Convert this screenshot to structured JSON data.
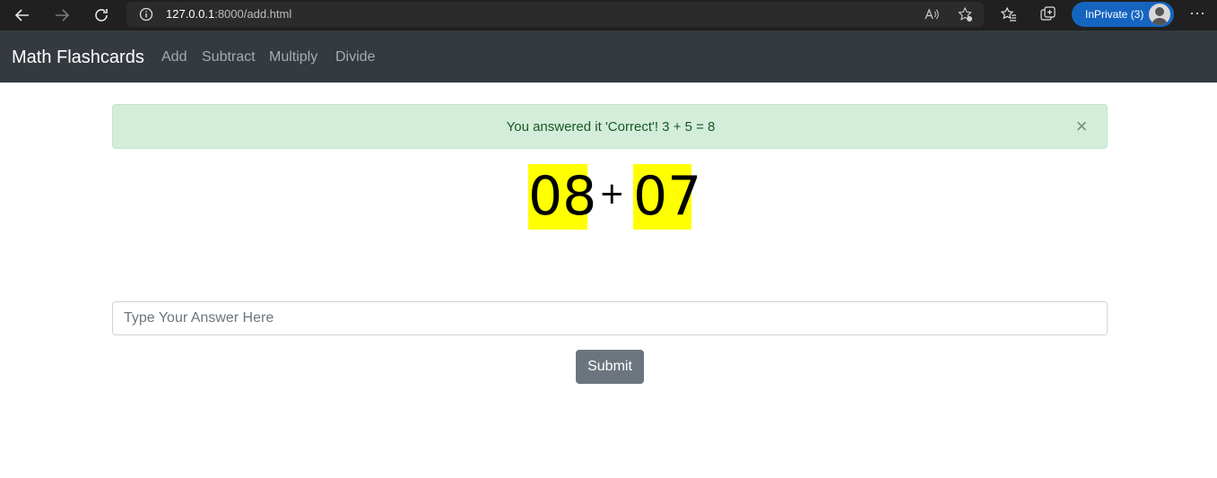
{
  "browser": {
    "url_host": "127.0.0.1",
    "url_rest": ":8000/add.html",
    "inprivate_label": "InPrivate (3)",
    "more_label": "···"
  },
  "navbar": {
    "brand": "Math Flashcards",
    "links": [
      "Add",
      "Subtract",
      "Multiply",
      "Divide"
    ]
  },
  "alert": {
    "message": "You answered it 'Correct'! 3 + 5 = 8",
    "close_label": "×"
  },
  "problem": {
    "left": "08",
    "operator": "+",
    "right": "07",
    "highlight_color": "#ffff00"
  },
  "form": {
    "answer_placeholder": "Type Your Answer Here",
    "submit_label": "Submit"
  }
}
